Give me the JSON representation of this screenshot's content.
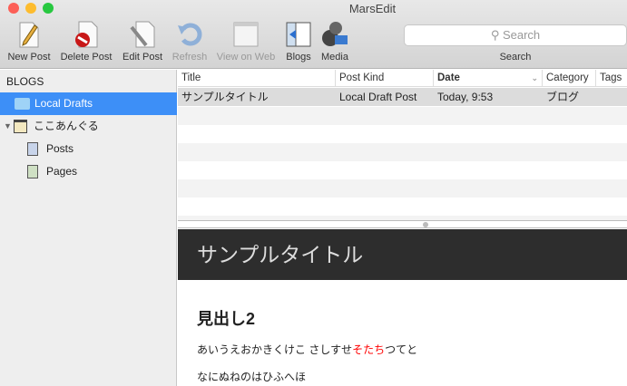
{
  "window": {
    "title": "MarsEdit"
  },
  "toolbar": {
    "items": [
      {
        "label": "New Post",
        "icon": "pencil-page-icon",
        "enabled": true
      },
      {
        "label": "Delete Post",
        "icon": "delete-page-icon",
        "enabled": true
      },
      {
        "label": "Edit Post",
        "icon": "wrench-page-icon",
        "enabled": true
      },
      {
        "label": "Refresh",
        "icon": "refresh-icon",
        "enabled": false
      },
      {
        "label": "View on Web",
        "icon": "browser-window-icon",
        "enabled": false
      },
      {
        "label": "Blogs",
        "icon": "blogs-drawer-icon",
        "enabled": true
      },
      {
        "label": "Media",
        "icon": "film-reel-icon",
        "enabled": true
      }
    ],
    "search_placeholder": "Search",
    "search_label": "Search"
  },
  "sidebar": {
    "heading": "BLOGS",
    "items": [
      {
        "label": "Local Drafts",
        "selected": true
      },
      {
        "label": "ここあんぐる"
      },
      {
        "label": "Posts"
      },
      {
        "label": "Pages"
      }
    ]
  },
  "table": {
    "columns": [
      "Title",
      "Post Kind",
      "Date",
      "Category",
      "Tags"
    ],
    "rows": [
      [
        "サンプルタイトル",
        "Local Draft Post",
        "Today, 9:53",
        "ブログ",
        ""
      ]
    ]
  },
  "preview": {
    "title": "サンプルタイトル",
    "heading": "見出し2",
    "para1_a": "あいうえおかきくけこ さしすせ",
    "para1_red": "そたち",
    "para1_b": "つてと",
    "para2": "なにぬねのはひふへほ",
    "accent": "#ff0000"
  }
}
